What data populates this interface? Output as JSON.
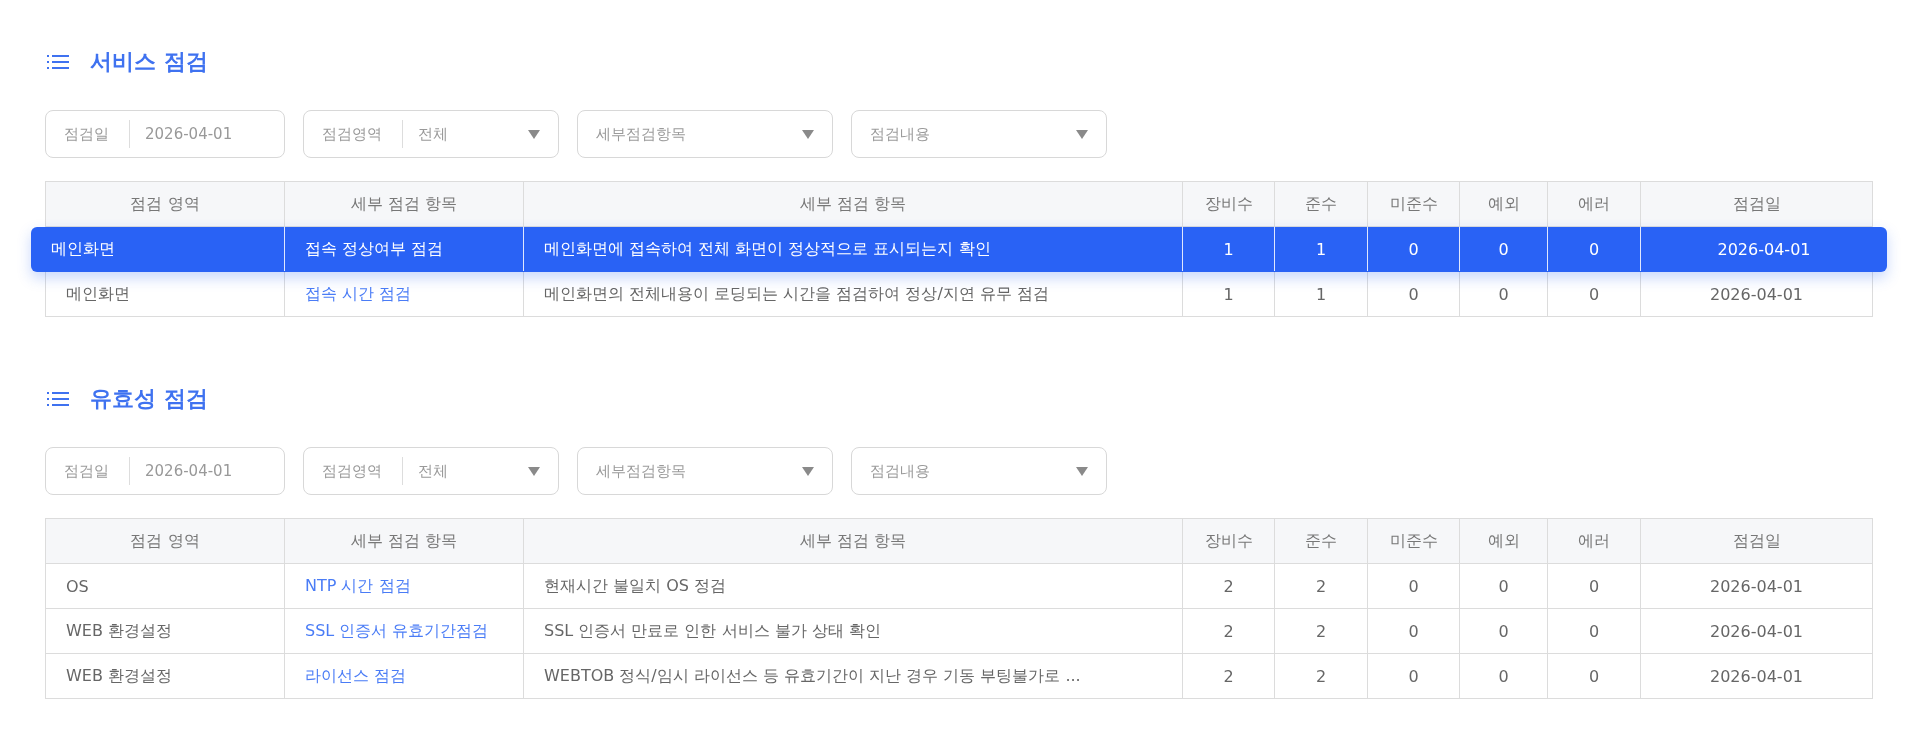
{
  "sections": [
    {
      "title": "서비스 점검",
      "filters": [
        {
          "kind": "date",
          "label": "점검일",
          "value": "2026-04-01"
        },
        {
          "kind": "labeled-select",
          "label": "점검영역",
          "value": "전체"
        },
        {
          "kind": "select",
          "placeholder": "세부점검항목"
        },
        {
          "kind": "select",
          "placeholder": "점검내용"
        }
      ],
      "table": {
        "columns": [
          "점검 영역",
          "세부 점검 항목",
          "세부 점검 항목",
          "장비수",
          "준수",
          "미준수",
          "예외",
          "에러",
          "점검일"
        ],
        "rows": [
          {
            "selected": true,
            "cells": [
              "메인화면",
              "접속 정상여부 점검",
              "메인화면에 접속하여 전체 화면이 정상적으로 표시되는지 확인",
              "1",
              "1",
              "0",
              "0",
              "0",
              "2026-04-01"
            ]
          },
          {
            "selected": false,
            "cells": [
              "메인화면",
              "접속 시간 점검",
              "메인화면의 전체내용이 로딩되는 시간을 점검하여 정상/지연 유무 점검",
              "1",
              "1",
              "0",
              "0",
              "0",
              "2026-04-01"
            ]
          }
        ]
      }
    },
    {
      "title": "유효성 점검",
      "filters": [
        {
          "kind": "date",
          "label": "점검일",
          "value": "2026-04-01"
        },
        {
          "kind": "labeled-select",
          "label": "점검영역",
          "value": "전체"
        },
        {
          "kind": "select",
          "placeholder": "세부점검항목"
        },
        {
          "kind": "select",
          "placeholder": "점검내용"
        }
      ],
      "table": {
        "columns": [
          "점검 영역",
          "세부 점검 항목",
          "세부 점검 항목",
          "장비수",
          "준수",
          "미준수",
          "예외",
          "에러",
          "점검일"
        ],
        "rows": [
          {
            "selected": false,
            "cells": [
              "OS",
              "NTP 시간 점검",
              "현재시간 불일치 OS 정검",
              "2",
              "2",
              "0",
              "0",
              "0",
              "2026-04-01"
            ]
          },
          {
            "selected": false,
            "cells": [
              "WEB 환경설정",
              "SSL 인증서 유효기간점검",
              "SSL 인증서 만료로 인한 서비스 불가 상태 확인",
              "2",
              "2",
              "0",
              "0",
              "0",
              "2026-04-01"
            ]
          },
          {
            "selected": false,
            "cells": [
              "WEB 환경설정",
              "라이선스 점검",
              "WEBTOB 정식/임시 라이선스 등 유효기간이 지난 경우 기동 부팅불가로 ...",
              "2",
              "2",
              "0",
              "0",
              "0",
              "2026-04-01"
            ]
          }
        ]
      }
    }
  ]
}
